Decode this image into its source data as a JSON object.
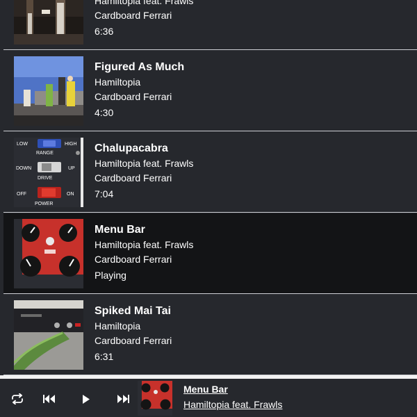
{
  "tracks": [
    {
      "title": "",
      "artist": "Hamiltopia feat. Frawls",
      "album": "Cardboard Ferrari",
      "status": "6:36",
      "thumb": "band-stage-thumbnail",
      "playing": false
    },
    {
      "title": "Figured As Much",
      "artist": "Hamiltopia",
      "album": "Cardboard Ferrari",
      "status": "4:30",
      "thumb": "outdoor-band-thumbnail",
      "playing": false
    },
    {
      "title": "Chalupacabra",
      "artist": "Hamiltopia feat. Frawls",
      "album": "Cardboard Ferrari",
      "status": "7:04",
      "thumb": "pedal-switches-thumbnail",
      "playing": false
    },
    {
      "title": "Menu Bar",
      "artist": "Hamiltopia feat. Frawls",
      "album": "Cardboard Ferrari",
      "status": "Playing",
      "thumb": "red-pedal-thumbnail",
      "playing": true
    },
    {
      "title": "Spiked Mai Tai",
      "artist": "Hamiltopia",
      "album": "Cardboard Ferrari",
      "status": "6:31",
      "thumb": "audio-interface-thumbnail",
      "playing": false
    }
  ],
  "pedal_labels": {
    "low": "LOW",
    "range": "RANGE",
    "high": "HIGH",
    "down": "DOWN",
    "drive": "DRIVE",
    "up": "UP",
    "off": "OFF",
    "power": "POWER",
    "on": "ON"
  },
  "now_playing": {
    "title": "Menu Bar",
    "artist": "Hamiltopia feat. Frawls"
  },
  "controls": {
    "repeat": "repeat-icon",
    "previous": "skip-previous-icon",
    "play": "play-icon",
    "next": "skip-next-icon"
  },
  "colors": {
    "background": "#26282d",
    "playing_row": "#131416",
    "divider": "#cfd1d6",
    "text": "#ffffff"
  }
}
